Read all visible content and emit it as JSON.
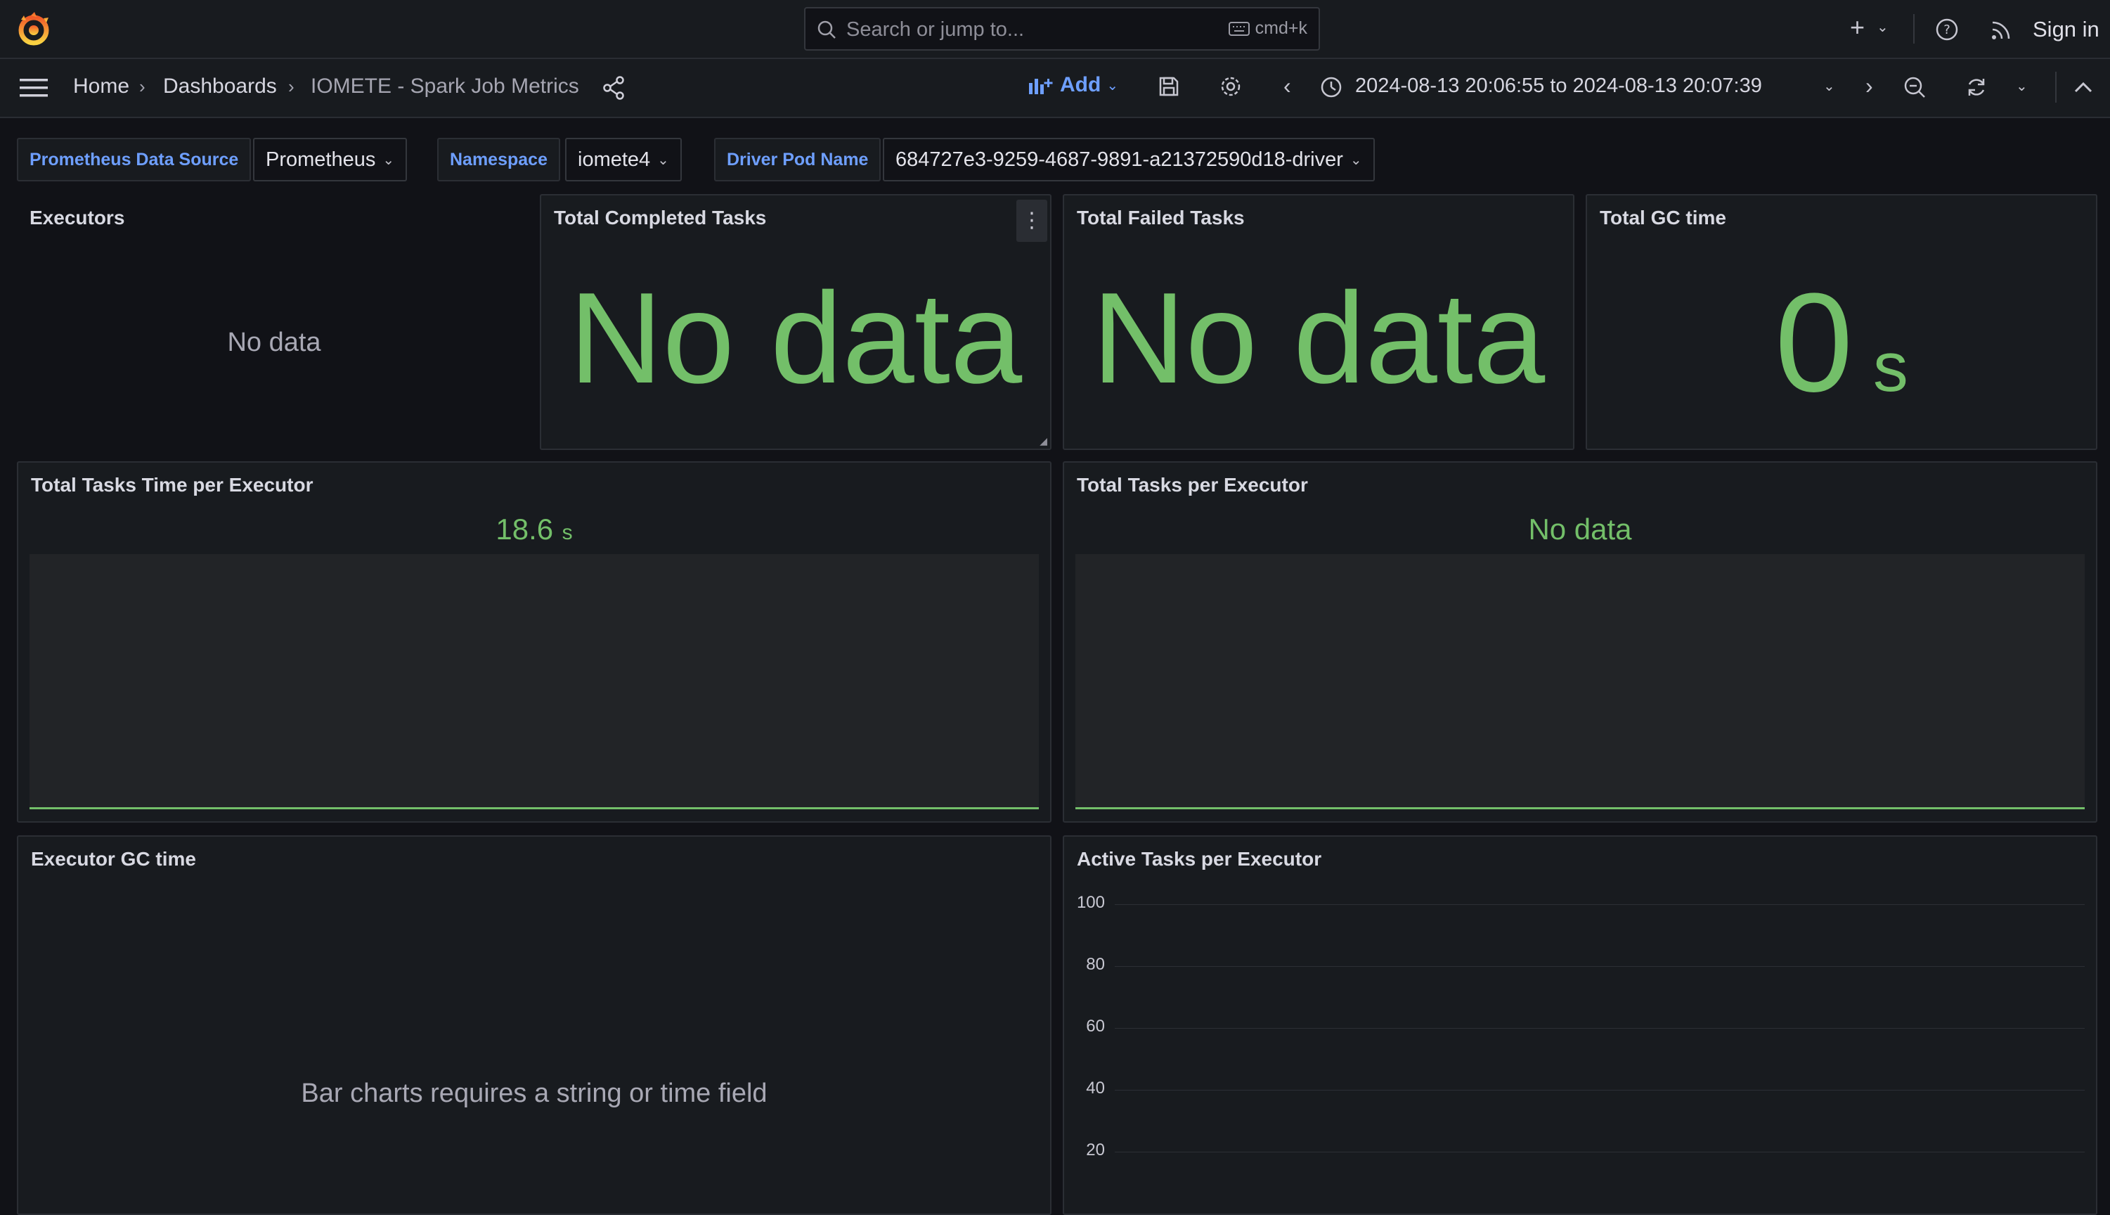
{
  "topbar": {
    "search_placeholder": "Search or jump to...",
    "search_shortcut": "cmd+k",
    "sign_in": "Sign in"
  },
  "breadcrumb": {
    "home": "Home",
    "dashboards": "Dashboards",
    "current": "IOMETE - Spark Job Metrics"
  },
  "toolbar": {
    "add_label": "Add",
    "time_range": "2024-08-13 20:06:55 to 2024-08-13 20:07:39"
  },
  "variables": [
    {
      "label": "Prometheus Data Source",
      "value": "Prometheus"
    },
    {
      "label": "Namespace",
      "value": "iomete4"
    },
    {
      "label": "Driver Pod Name",
      "value": "684727e3-9259-4687-9891-a21372590d18-driver"
    }
  ],
  "panels": {
    "executors": {
      "title": "Executors",
      "value": "No data"
    },
    "completed": {
      "title": "Total Completed Tasks",
      "value": "No data"
    },
    "failed": {
      "title": "Total Failed Tasks",
      "value": "No data"
    },
    "gc_total": {
      "title": "Total GC time",
      "value": "0",
      "unit": "s"
    },
    "tasks_time": {
      "title": "Total Tasks Time per Executor",
      "value": "18.6",
      "unit": "s"
    },
    "tasks_per_exec": {
      "title": "Total Tasks per Executor",
      "value": "No data"
    },
    "exec_gc": {
      "title": "Executor GC time",
      "message": "Bar charts requires a string or time field"
    },
    "active_tasks": {
      "title": "Active Tasks per Executor",
      "y_ticks": [
        "100",
        "80",
        "60",
        "40",
        "20"
      ]
    }
  },
  "colors": {
    "background": "#111217",
    "panel": "#181b1f",
    "value_green": "#73bf69",
    "link_blue": "#6e9fff",
    "logo_orange": "#f46800"
  }
}
